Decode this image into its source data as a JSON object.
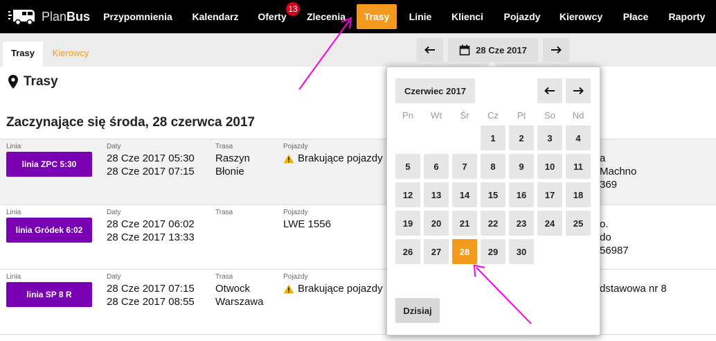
{
  "brand": {
    "prefix": "Plan",
    "suffix": "Bus"
  },
  "nav": {
    "items": [
      {
        "label": "Przypomnienia",
        "active": false
      },
      {
        "label": "Kalendarz",
        "active": false
      },
      {
        "label": "Oferty",
        "active": false,
        "badge": "13"
      },
      {
        "label": "Zlecenia",
        "active": false
      },
      {
        "label": "Trasy",
        "active": true
      },
      {
        "label": "Linie",
        "active": false
      },
      {
        "label": "Klienci",
        "active": false
      },
      {
        "label": "Pojazdy",
        "active": false
      },
      {
        "label": "Kierowcy",
        "active": false
      },
      {
        "label": "Płace",
        "active": false
      },
      {
        "label": "Raporty",
        "active": false
      }
    ],
    "accent": "#f39a1e",
    "badge_color": "#d0011b"
  },
  "subtabs": [
    {
      "label": "Trasy",
      "active": true
    },
    {
      "label": "Kierowcy",
      "active": false
    }
  ],
  "date_nav": {
    "current": "28 Cze 2017",
    "prev_icon": "arrow-left-icon",
    "next_icon": "arrow-right-icon",
    "calendar_icon": "calendar-icon"
  },
  "page": {
    "title": "Trasy",
    "icon": "map-marker-icon"
  },
  "section_title": "Zaczynające się środa, 28 czerwca 2017",
  "labels": {
    "linia": "Linia",
    "daty": "Daty",
    "trasa": "Trasa",
    "pojazdy": "Pojazdy"
  },
  "routes": [
    {
      "line": "linia ZPC 5:30",
      "date_start": "28 Cze 2017 05:30",
      "date_end": "28 Cze 2017 07:15",
      "route_from": "Raszyn",
      "route_to": "Błonie",
      "vehicles": "Brakujące pojazdy",
      "vehicles_warning": true,
      "right_1": "a",
      "right_2": "Machno",
      "right_3": "369"
    },
    {
      "line": "linia Gródek 6:02",
      "date_start": "28 Cze 2017 06:02",
      "date_end": "28 Cze 2017 13:33",
      "route_from": "",
      "route_to": "",
      "vehicles": "LWE 1556",
      "vehicles_warning": false,
      "right_1": "o.",
      "right_2": "do",
      "right_3": "56987"
    },
    {
      "line": "linia SP 8 R",
      "date_start": "28 Cze 2017 07:15",
      "date_end": "28 Cze 2017 08:55",
      "route_from": "Otwock",
      "route_to": "Warszawa",
      "vehicles": "Brakujące pojazdy",
      "vehicles_warning": true,
      "right_1": "dstawowa nr 8",
      "right_2": "",
      "right_3": ""
    }
  ],
  "line_color": "#7a00b3",
  "calendar": {
    "month_label": "Czerwiec 2017",
    "weekdays": [
      "Pn",
      "Wt",
      "Śr",
      "Cz",
      "Pt",
      "So",
      "Nd"
    ],
    "first_weekday_index": 3,
    "days_in_month": 30,
    "selected_day": 28,
    "today_label": "Dzisiaj"
  },
  "annotation_color": "#ff00dd"
}
